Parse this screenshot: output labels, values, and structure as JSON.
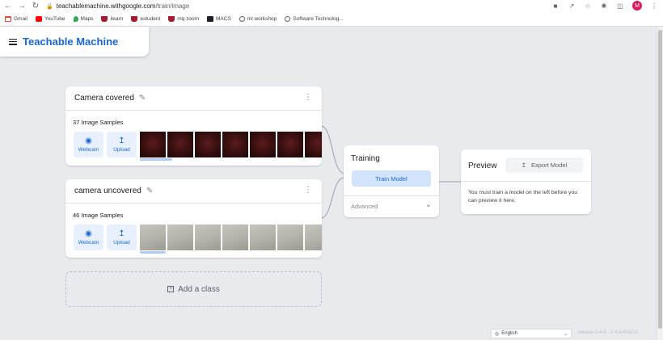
{
  "browser": {
    "url_domain": "teachablemachine.withgoogle.com",
    "url_path": "/train/image",
    "avatar_letter": "M"
  },
  "bookmarks": [
    {
      "label": "Gmail",
      "color": "#ea4335"
    },
    {
      "label": "YouTube",
      "color": "#ff0000"
    },
    {
      "label": "Maps",
      "color": "#34a853"
    },
    {
      "label": "ilearn",
      "color": "#a51c30"
    },
    {
      "label": "estudent",
      "color": "#a51c30"
    },
    {
      "label": "mq zoom",
      "color": "#a51c30"
    },
    {
      "label": "MACS",
      "color": "#202124"
    },
    {
      "label": "ml workshop",
      "color": "#5f6368"
    },
    {
      "label": "Software Technolog...",
      "color": "#5f6368"
    }
  ],
  "app": {
    "title": "Teachable Machine",
    "accent_color": "#1967d2"
  },
  "classes": [
    {
      "name": "Camera covered",
      "samples_label": "37 Image Samples",
      "webcam_label": "Webcam",
      "upload_label": "Upload",
      "thumb_style": "dark"
    },
    {
      "name": "camera uncovered",
      "samples_label": "46 Image Samples",
      "webcam_label": "Webcam",
      "upload_label": "Upload",
      "thumb_style": "light"
    }
  ],
  "add_class_label": "Add a class",
  "training": {
    "title": "Training",
    "train_button": "Train Model",
    "advanced_label": "Advanced"
  },
  "preview": {
    "title": "Preview",
    "export_button": "Export Model",
    "message": "You must train a model on the left before you can preview it here."
  },
  "footer": {
    "language": "English",
    "release": "release-2-4-5 - 2.4.5#f0d7c1"
  }
}
